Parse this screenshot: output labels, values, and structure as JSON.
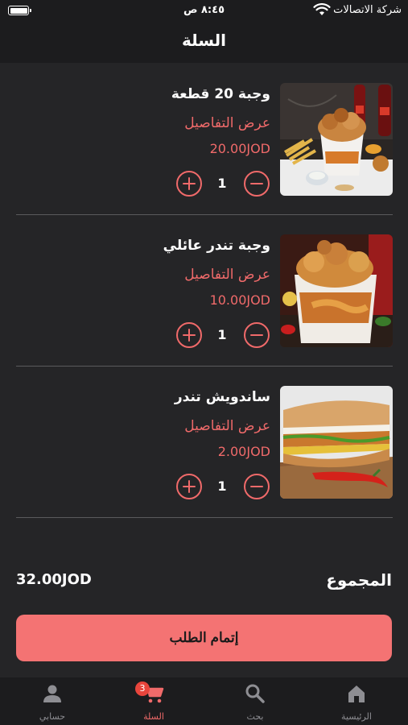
{
  "status_bar": {
    "carrier": "شركة الاتصالات",
    "time": "٨:٤٥ ص"
  },
  "header": {
    "title": "السلة"
  },
  "cart": {
    "items": [
      {
        "name": "وجبة 20 قطعة",
        "details_link": "عرض التفاصيل",
        "price": "20.00JOD",
        "quantity": "1",
        "image": "fried-chicken-bucket-with-fries-and-cola"
      },
      {
        "name": "وجبة تندر عائلي",
        "details_link": "عرض التفاصيل",
        "price": "10.00JOD",
        "quantity": "1",
        "image": "tender-bucket-with-fries"
      },
      {
        "name": "ساندويش تندر",
        "details_link": "عرض التفاصيل",
        "price": "2.00JOD",
        "quantity": "1",
        "image": "tender-sub-sandwich-with-chili"
      }
    ]
  },
  "summary": {
    "total_label": "المجموع",
    "total_value": "32.00JOD"
  },
  "checkout_button": {
    "label": "إتمام الطلب"
  },
  "tab_bar": {
    "tabs": [
      {
        "label": "الرئيسية",
        "icon": "home-icon"
      },
      {
        "label": "بحث",
        "icon": "search-icon"
      },
      {
        "label": "السلة",
        "icon": "cart-icon",
        "badge": "3",
        "active": true
      },
      {
        "label": "حسابي",
        "icon": "person-icon"
      }
    ]
  },
  "colors": {
    "background": "#252527",
    "bars": "#1c1c1e",
    "accent": "#f06a6a",
    "checkout": "#f47373",
    "badge": "#e8453c"
  }
}
